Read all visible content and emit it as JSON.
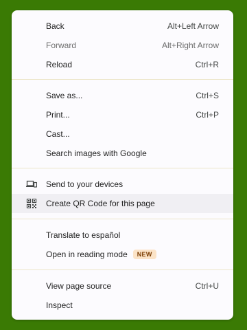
{
  "menu": {
    "back": {
      "label": "Back",
      "shortcut": "Alt+Left Arrow"
    },
    "forward": {
      "label": "Forward",
      "shortcut": "Alt+Right Arrow"
    },
    "reload": {
      "label": "Reload",
      "shortcut": "Ctrl+R"
    },
    "save_as": {
      "label": "Save as...",
      "shortcut": "Ctrl+S"
    },
    "print": {
      "label": "Print...",
      "shortcut": "Ctrl+P"
    },
    "cast": {
      "label": "Cast..."
    },
    "search_images": {
      "label": "Search images with Google"
    },
    "send_devices": {
      "label": "Send to your devices",
      "icon": "laptop-phone-icon"
    },
    "qr_code": {
      "label": "Create QR Code for this page",
      "icon": "qr-code-icon"
    },
    "translate": {
      "label": "Translate to español"
    },
    "reading_mode": {
      "label": "Open in reading mode",
      "badge": "NEW"
    },
    "view_source": {
      "label": "View page source",
      "shortcut": "Ctrl+U"
    },
    "inspect": {
      "label": "Inspect"
    }
  },
  "colors": {
    "background": "#3a7a04",
    "menu_bg": "#fcfbfe",
    "highlight": "#f0eff3",
    "badge_bg": "#fbe3c7",
    "badge_text": "#7a3b00"
  }
}
